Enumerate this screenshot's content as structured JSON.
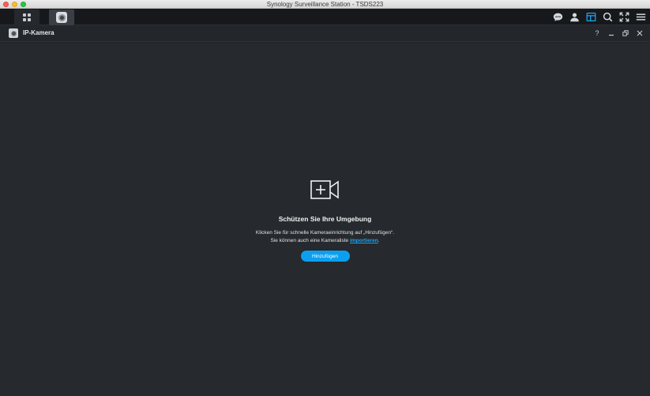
{
  "window": {
    "title": "Synology Surveillance Station - TSDS223"
  },
  "appbar": {
    "apps": [
      {
        "name": "main-menu",
        "icon": "grid-icon"
      },
      {
        "name": "ip-camera",
        "icon": "camera-icon"
      }
    ],
    "right_icons": [
      "chat-icon",
      "user-icon",
      "layout-icon",
      "search-icon",
      "fullscreen-icon",
      "menu-icon"
    ],
    "active_icon_color": "#1ea4f0"
  },
  "panel": {
    "title": "IP-Kamera",
    "controls": {
      "help": "?"
    }
  },
  "empty_state": {
    "icon": "add-camera-icon",
    "heading": "Schützen Sie Ihre Umgebung",
    "line1": "Klicken Sie für schnelle Kameraeinrichtung auf „Hinzufügen“.",
    "line2_prefix": "Sie können auch eine Kameraliste ",
    "line2_link": "importieren",
    "line2_suffix": ".",
    "button_label": "Hinzufügen"
  },
  "colors": {
    "accent": "#0c9ff0",
    "background": "#26292d"
  }
}
